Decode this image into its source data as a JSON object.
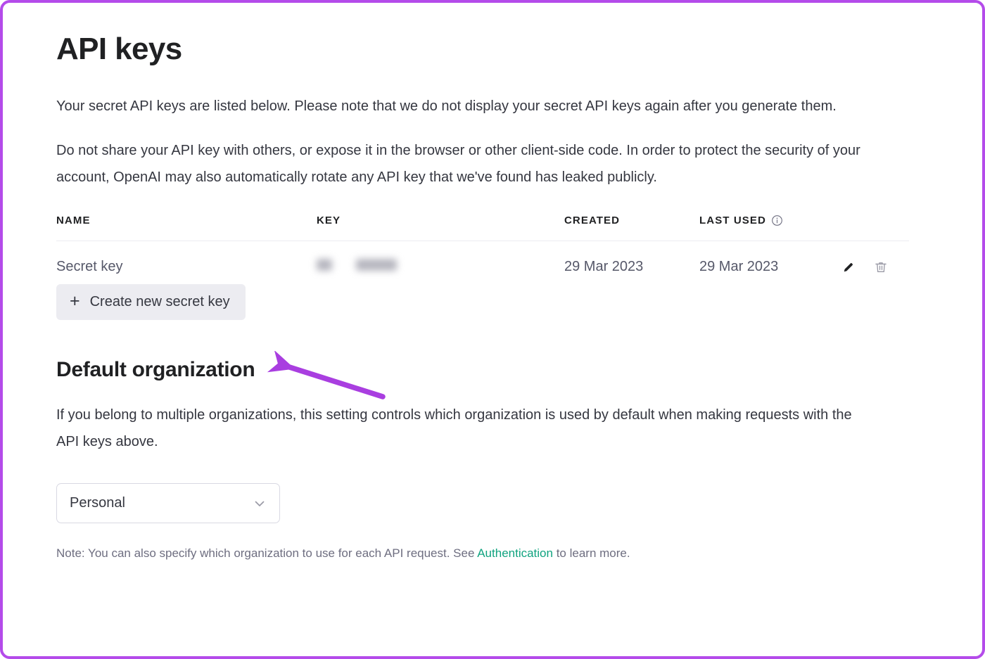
{
  "annotation": {
    "frame_color": "#b44bea",
    "arrow_color": "#a93ee0",
    "arrow_name": "purple-pointer-arrow"
  },
  "page": {
    "title": "API keys",
    "intro_paragraph": "Your secret API keys are listed below. Please note that we do not display your secret API keys again after you generate them.",
    "warning_paragraph": "Do not share your API key with others, or expose it in the browser or other client-side code. In order to protect the security of your account, OpenAI may also automatically rotate any API key that we've found has leaked publicly."
  },
  "keys_table": {
    "columns": [
      "NAME",
      "KEY",
      "CREATED",
      "LAST USED"
    ],
    "last_used_info_icon": "info-circle-icon",
    "rows": [
      {
        "name": "Secret key",
        "key": "",
        "key_state": "hidden-blurred",
        "created": "29 Mar 2023",
        "last_used": "29 Mar 2023",
        "edit_icon": "pencil-icon",
        "delete_icon": "trash-icon"
      }
    ]
  },
  "create_button": {
    "plus": "+",
    "label": "Create new secret key"
  },
  "organization": {
    "title": "Default organization",
    "description": "If you belong to multiple organizations, this setting controls which organization is used by default when making requests with the API keys above.",
    "select_value": "Personal",
    "select_options": [
      "Personal"
    ],
    "chevron_icon": "chevron-down-icon",
    "note_prefix": "Note: You can also specify which organization to use for each API request. See ",
    "note_link": "Authentication",
    "note_suffix": " to learn more.",
    "link_color": "#10a37f"
  }
}
